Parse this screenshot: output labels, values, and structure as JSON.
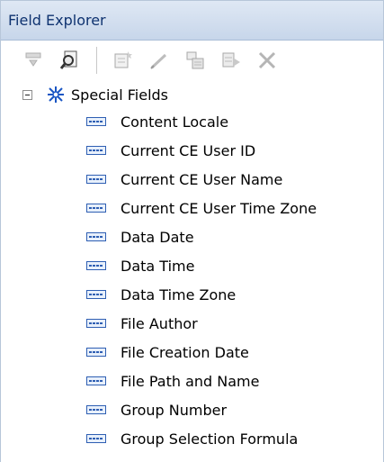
{
  "panel": {
    "title": "Field Explorer"
  },
  "toolbar": {
    "buttons": [
      {
        "name": "insert-to-report-icon"
      },
      {
        "name": "browse-data-icon"
      },
      {
        "name": "new-field-icon"
      },
      {
        "name": "edit-field-icon"
      },
      {
        "name": "duplicate-field-icon"
      },
      {
        "name": "rename-field-icon"
      },
      {
        "name": "delete-icon"
      }
    ]
  },
  "tree": {
    "root": {
      "label": "Special Fields",
      "expanded": true
    },
    "items": [
      {
        "label": "Content Locale"
      },
      {
        "label": "Current CE User ID"
      },
      {
        "label": "Current CE User Name"
      },
      {
        "label": "Current CE User Time Zone"
      },
      {
        "label": "Data Date"
      },
      {
        "label": "Data Time"
      },
      {
        "label": "Data Time Zone"
      },
      {
        "label": "File Author"
      },
      {
        "label": "File Creation Date"
      },
      {
        "label": "File Path and Name"
      },
      {
        "label": "Group Number"
      },
      {
        "label": "Group Selection Formula"
      }
    ]
  }
}
